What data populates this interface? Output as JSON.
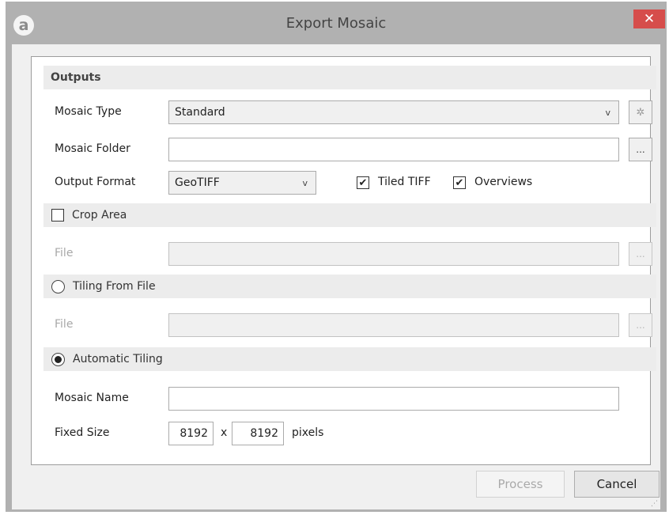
{
  "window": {
    "title": "Export Mosaic",
    "app_icon": "a",
    "close_glyph": "✕"
  },
  "outputs": {
    "header": "Outputs",
    "mosaic_type": {
      "label": "Mosaic Type",
      "value": "Standard",
      "settings_icon": "gear-icon"
    },
    "mosaic_folder": {
      "label": "Mosaic Folder",
      "value": "",
      "browse_label": "..."
    },
    "output_format": {
      "label": "Output Format",
      "value": "GeoTIFF"
    },
    "tiled_tiff": {
      "label": "Tiled TIFF",
      "checked": true
    },
    "overviews": {
      "label": "Overviews",
      "checked": true
    }
  },
  "crop_area": {
    "header": "Crop Area",
    "checked": false,
    "file_label": "File",
    "browse_label": "..."
  },
  "tiling_from_file": {
    "header": "Tiling From File",
    "selected": false,
    "file_label": "File",
    "browse_label": "..."
  },
  "automatic_tiling": {
    "header": "Automatic Tiling",
    "selected": true,
    "mosaic_name_label": "Mosaic Name",
    "mosaic_name_value": "",
    "fixed_size_label": "Fixed Size",
    "width": "8192",
    "times": "x",
    "height": "8192",
    "unit": "pixels"
  },
  "footer": {
    "process_label": "Process",
    "cancel_label": "Cancel"
  },
  "check_glyph": "✔",
  "chevron_glyph": "v",
  "gear_glyph": "✲"
}
